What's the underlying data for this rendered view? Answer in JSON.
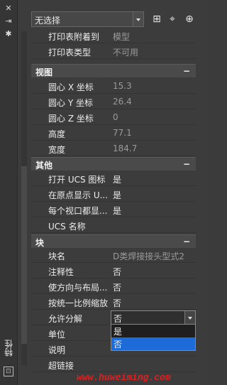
{
  "panel": {
    "title": "特性",
    "selection_value": "无选择"
  },
  "sections": {
    "top_rows": [
      {
        "label": "打印表附着到",
        "value": "模型",
        "dim": true
      },
      {
        "label": "打印表类型",
        "value": "不可用",
        "dim": true
      }
    ],
    "view": {
      "title": "视图",
      "rows": [
        {
          "label": "圆心 X 坐标",
          "value": "15.3",
          "dim": true
        },
        {
          "label": "圆心 Y 坐标",
          "value": "26.4",
          "dim": true
        },
        {
          "label": "圆心 Z 坐标",
          "value": "0",
          "dim": true
        },
        {
          "label": "高度",
          "value": "77.1",
          "dim": true
        },
        {
          "label": "宽度",
          "value": "184.7",
          "dim": true
        }
      ]
    },
    "other": {
      "title": "其他",
      "rows": [
        {
          "label": "打开 UCS 图标",
          "value": "是",
          "dim": false
        },
        {
          "label": "在原点显示 U...",
          "value": "是",
          "dim": false
        },
        {
          "label": "每个视口都显...",
          "value": "是",
          "dim": false
        },
        {
          "label": "UCS 名称",
          "value": "",
          "dim": false
        }
      ]
    },
    "block": {
      "title": "块",
      "rows": [
        {
          "label": "块名",
          "value": "D类焊接接头型式2",
          "dim": true
        },
        {
          "label": "注释性",
          "value": "否",
          "dim": false
        },
        {
          "label": "使方向与布局...",
          "value": "否",
          "dim": false
        },
        {
          "label": "按统一比例缩放",
          "value": "否",
          "dim": false
        },
        {
          "label": "允许分解",
          "value": "否",
          "dim": false
        },
        {
          "label": "单位",
          "value": "",
          "dim": false
        },
        {
          "label": "说明",
          "value": "",
          "dim": false
        },
        {
          "label": "超链接",
          "value": "",
          "dim": false
        }
      ],
      "dropdown_options": [
        "是",
        "否"
      ],
      "dropdown_selected": "否"
    }
  },
  "watermark": "www.huweiming.com",
  "icons": {
    "close": "close-icon",
    "pin": "pin-icon",
    "settings": "settings-icon",
    "quick_select": "quick-select-icon",
    "select_objects": "select-objects-icon",
    "pickadd": "pickadd-toggle-icon"
  }
}
